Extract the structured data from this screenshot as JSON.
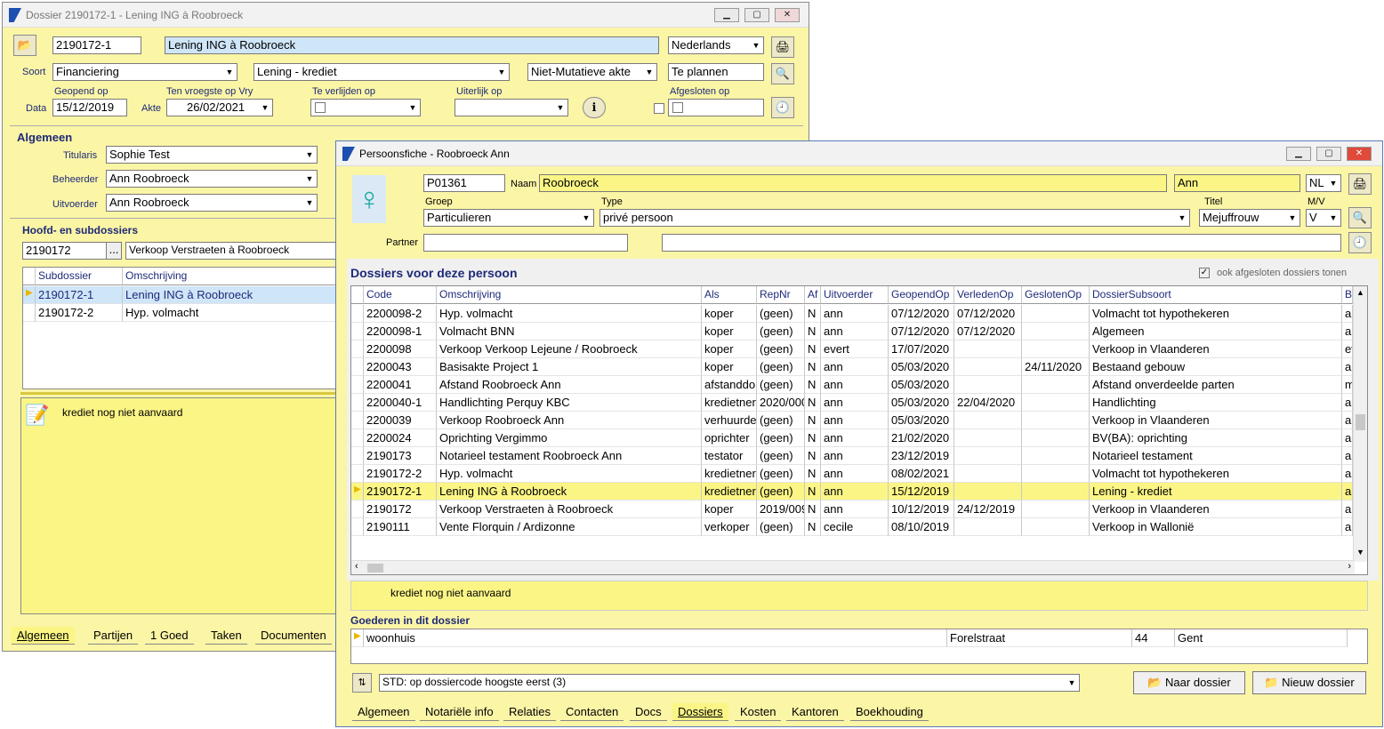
{
  "dossier": {
    "title": "Dossier 2190172-1 - Lening ING à Roobroeck",
    "code": "2190172-1",
    "name": "Lening ING à Roobroeck",
    "language": "Nederlands",
    "soort_label": "Soort",
    "soort": "Financiering",
    "soort2": "Lening - krediet",
    "akte_type": "Niet-Mutatieve akte",
    "status": "Te plannen",
    "geopend_label": "Geopend op",
    "vroegste_label": "Ten vroegste op Vry",
    "verlijden_label": "Te verlijden op",
    "uiterlijk_label": "Uiterlijk op",
    "afgesloten_label": "Afgesloten op",
    "data_label": "Data",
    "geopend": "15/12/2019",
    "akte_label": "Akte",
    "akte_date": "26/02/2021",
    "algemeen": "Algemeen",
    "titularis_label": "Titularis",
    "titularis": "Sophie Test",
    "beheerder_label": "Beheerder",
    "beheerder": "Ann Roobroeck",
    "uitvoerder_label": "Uitvoerder",
    "uitvoerder": "Ann Roobroeck",
    "hoofd_label": "Hoofd- en subdossiers",
    "hoofd_code": "2190172",
    "hoofd_btn": "...",
    "hoofd_desc": "Verkoop Verstraeten à Roobroeck",
    "sub_headers": [
      "Subdossier",
      "Omschrijving"
    ],
    "sub_rows": [
      [
        "2190172-1",
        "Lening ING à Roobroeck"
      ],
      [
        "2190172-2",
        "Hyp. volmacht"
      ]
    ],
    "memo": "krediet nog niet aanvaard",
    "tabs": [
      "Algemeen",
      "Partijen",
      "1 Goed",
      "Taken",
      "Documenten"
    ]
  },
  "person": {
    "title": "Persoonsfiche - Roobroeck Ann",
    "id": "P01361",
    "naam_label": "Naam",
    "naam": "Roobroeck",
    "voornaam": "Ann",
    "lang": "NL",
    "groep_label": "Groep",
    "groep": "Particulieren",
    "type_label": "Type",
    "type": "privé persoon",
    "titel_label": "Titel",
    "titel": "Mejuffrouw",
    "mv_label": "M/V",
    "mv": "V",
    "partner_label": "Partner",
    "dossiers_header": "Dossiers voor deze persoon",
    "show_closed": "ook afgesloten dossiers tonen",
    "columns": [
      "Code",
      "Omschrijving",
      "Als",
      "RepNr",
      "Af",
      "Uitvoerder",
      "GeopendOp",
      "VerledenOp",
      "GeslotenOp",
      "DossierSubsoort",
      "B"
    ],
    "rows": [
      [
        "2200098-2",
        "Hyp. volmacht",
        "koper",
        "(geen)",
        "N",
        "ann",
        "07/12/2020",
        "07/12/2020",
        "",
        "Volmacht tot hypothekeren",
        "an"
      ],
      [
        "2200098-1",
        "Volmacht  BNN",
        "koper",
        "(geen)",
        "N",
        "ann",
        "07/12/2020",
        "07/12/2020",
        "",
        "Algemeen",
        "an"
      ],
      [
        "2200098",
        "Verkoop Verkoop Lejeune / Roobroeck",
        "koper",
        "(geen)",
        "N",
        "evert",
        "17/07/2020",
        "",
        "",
        "Verkoop in Vlaanderen",
        "ev"
      ],
      [
        "2200043",
        "Basisakte Project 1",
        "koper",
        "(geen)",
        "N",
        "ann",
        "05/03/2020",
        "",
        "24/11/2020",
        "Bestaand gebouw",
        "an"
      ],
      [
        "2200041",
        "Afstand Roobroeck Ann",
        "afstanddo",
        "(geen)",
        "N",
        "ann",
        "05/03/2020",
        "",
        "",
        "Afstand onverdeelde parten",
        "m"
      ],
      [
        "2200040-1",
        "Handlichting Perquy KBC",
        "kredietner",
        "2020/000",
        "N",
        "ann",
        "05/03/2020",
        "22/04/2020",
        "",
        "Handlichting",
        "an"
      ],
      [
        "2200039",
        "Verkoop Roobroeck Ann",
        "verhuurder",
        "(geen)",
        "N",
        "ann",
        "05/03/2020",
        "",
        "",
        "Verkoop in Vlaanderen",
        "an"
      ],
      [
        "2200024",
        "Oprichting Vergimmo",
        "oprichter",
        "(geen)",
        "N",
        "ann",
        "21/02/2020",
        "",
        "",
        "BV(BA): oprichting",
        "an"
      ],
      [
        "2190173",
        "Notarieel testament Roobroeck Ann",
        "testator",
        "(geen)",
        "N",
        "ann",
        "23/12/2019",
        "",
        "",
        "Notarieel testament",
        "an"
      ],
      [
        "2190172-2",
        "Hyp. volmacht",
        "kredietner",
        "(geen)",
        "N",
        "ann",
        "08/02/2021",
        "",
        "",
        "Volmacht tot hypothekeren",
        "an"
      ],
      [
        "2190172-1",
        "Lening ING à Roobroeck",
        "kredietner",
        "(geen)",
        "N",
        "ann",
        "15/12/2019",
        "",
        "",
        "Lening - krediet",
        "an"
      ],
      [
        "2190172",
        "Verkoop Verstraeten à Roobroeck",
        "koper",
        "2019/009",
        "N",
        "ann",
        "10/12/2019",
        "24/12/2019",
        "",
        "Verkoop in Vlaanderen",
        "an"
      ],
      [
        "2190111",
        "Vente Florquin / Ardizonne",
        "verkoper",
        "(geen)",
        "N",
        "cecile",
        "08/10/2019",
        "",
        "",
        "Verkoop in Wallonië",
        "an"
      ]
    ],
    "memo": "krediet nog niet aanvaard",
    "goederen_label": "Goederen in dit dossier",
    "goed": [
      "woonhuis",
      "Forelstraat",
      "44",
      "Gent"
    ],
    "sort": "STD: op dossiercode hoogste eerst (3)",
    "naar_dossier": "Naar dossier",
    "nieuw_dossier": "Nieuw dossier",
    "tabs": [
      "Algemeen",
      "Notariële info",
      "Relaties",
      "Contacten",
      "Docs",
      "Dossiers",
      "Kosten",
      "Kantoren",
      "Boekhouding"
    ]
  },
  "colors": {
    "panel": "#fbf5a6",
    "highlight": "#fbf586",
    "label": "#1e2a78",
    "selected_blue": "#cfe6f8"
  }
}
